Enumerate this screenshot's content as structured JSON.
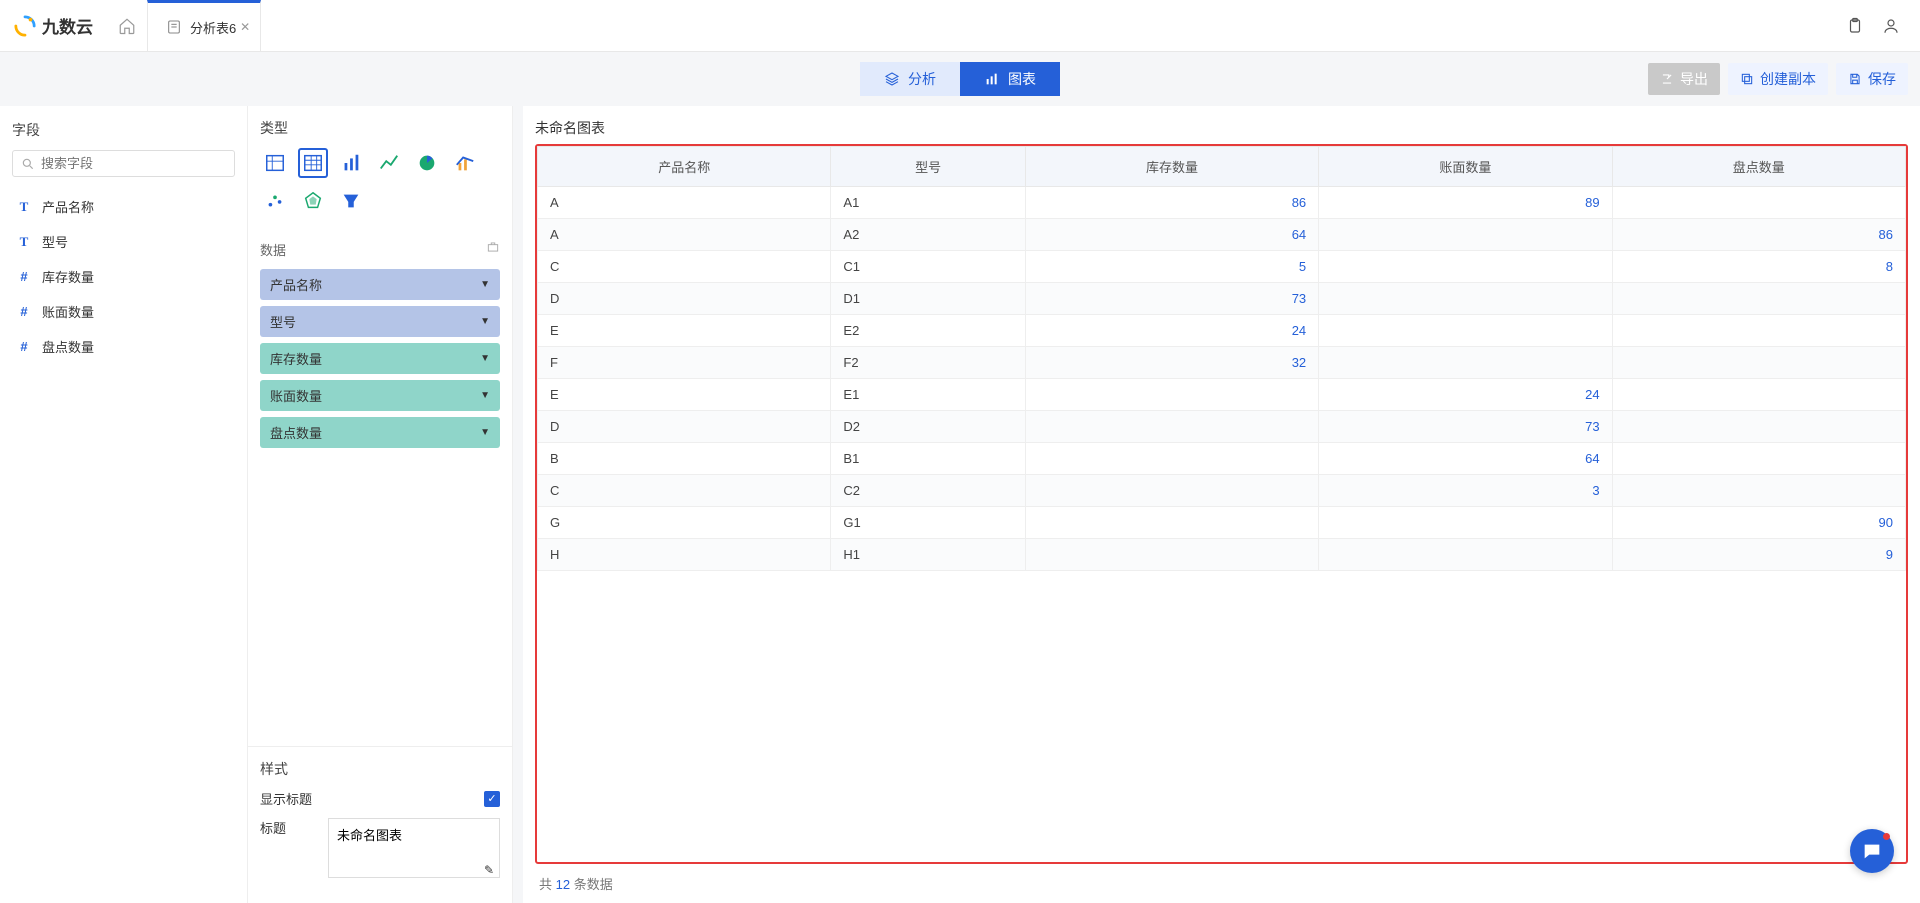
{
  "brand": "九数云",
  "tab": {
    "title": "分析表6"
  },
  "toolbar": {
    "mode_analysis": "分析",
    "mode_chart": "图表",
    "export": "导出",
    "duplicate": "创建副本",
    "save": "保存"
  },
  "left": {
    "title": "字段",
    "search_placeholder": "搜索字段",
    "fields": [
      {
        "type": "T",
        "label": "产品名称"
      },
      {
        "type": "T",
        "label": "型号"
      },
      {
        "type": "#",
        "label": "库存数量"
      },
      {
        "type": "#",
        "label": "账面数量"
      },
      {
        "type": "#",
        "label": "盘点数量"
      }
    ]
  },
  "mid": {
    "type_title": "类型",
    "data_title": "数据",
    "pills_dim": [
      "产品名称",
      "型号"
    ],
    "pills_mea": [
      "库存数量",
      "账面数量",
      "盘点数量"
    ],
    "style_title": "样式",
    "show_title_label": "显示标题",
    "title_label": "标题",
    "title_value": "未命名图表"
  },
  "main": {
    "chart_title": "未命名图表",
    "columns": [
      "产品名称",
      "型号",
      "库存数量",
      "账面数量",
      "盘点数量"
    ],
    "rows": [
      [
        "A",
        "A1",
        "86",
        "89",
        ""
      ],
      [
        "A",
        "A2",
        "64",
        "",
        "86"
      ],
      [
        "C",
        "C1",
        "5",
        "",
        "8"
      ],
      [
        "D",
        "D1",
        "73",
        "",
        ""
      ],
      [
        "E",
        "E2",
        "24",
        "",
        ""
      ],
      [
        "F",
        "F2",
        "32",
        "",
        ""
      ],
      [
        "E",
        "E1",
        "",
        "24",
        ""
      ],
      [
        "D",
        "D2",
        "",
        "73",
        ""
      ],
      [
        "B",
        "B1",
        "",
        "64",
        ""
      ],
      [
        "C",
        "C2",
        "",
        "3",
        ""
      ],
      [
        "G",
        "G1",
        "",
        "",
        "90"
      ],
      [
        "H",
        "H1",
        "",
        "",
        "9"
      ]
    ],
    "footer_prefix": "共",
    "footer_count": "12",
    "footer_suffix": "条数据"
  }
}
